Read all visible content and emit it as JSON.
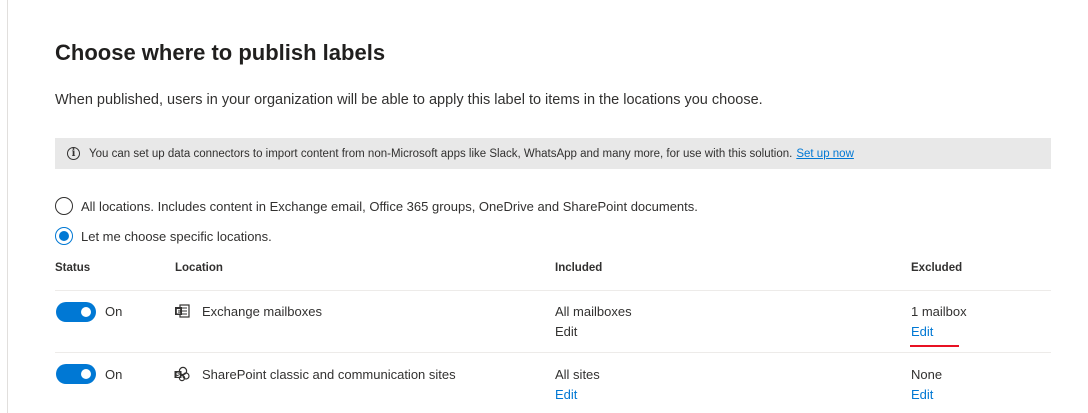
{
  "page": {
    "title": "Choose where to publish labels",
    "description": "When published, users in your organization will be able to apply this label to items in the locations you choose."
  },
  "info_bar": {
    "icon": "info-icon",
    "text": "You can set up data connectors to import content from non-Microsoft apps like Slack, WhatsApp and many more, for use with this solution.",
    "link": "Set up now"
  },
  "options": [
    {
      "label": "All locations. Includes content in Exchange email, Office 365 groups, OneDrive and SharePoint documents.",
      "selected": false
    },
    {
      "label": "Let me choose specific locations.",
      "selected": true
    }
  ],
  "table": {
    "headers": {
      "status": "Status",
      "location": "Location",
      "included": "Included",
      "excluded": "Excluded"
    },
    "rows": [
      {
        "status": "On",
        "toggle_on": true,
        "icon": "exchange-icon",
        "location": "Exchange mailboxes",
        "included": "All mailboxes",
        "included_edit": "Edit",
        "excluded": "1 mailbox",
        "excluded_edit": "Edit"
      },
      {
        "status": "On",
        "toggle_on": true,
        "icon": "sharepoint-icon",
        "location": "SharePoint classic and communication sites",
        "included": "All sites",
        "included_edit": "Edit",
        "excluded": "None",
        "excluded_edit": "Edit"
      }
    ]
  },
  "colors": {
    "accent": "#0078d4",
    "annotation": "#e81123",
    "bar": "#e8e8e8"
  }
}
